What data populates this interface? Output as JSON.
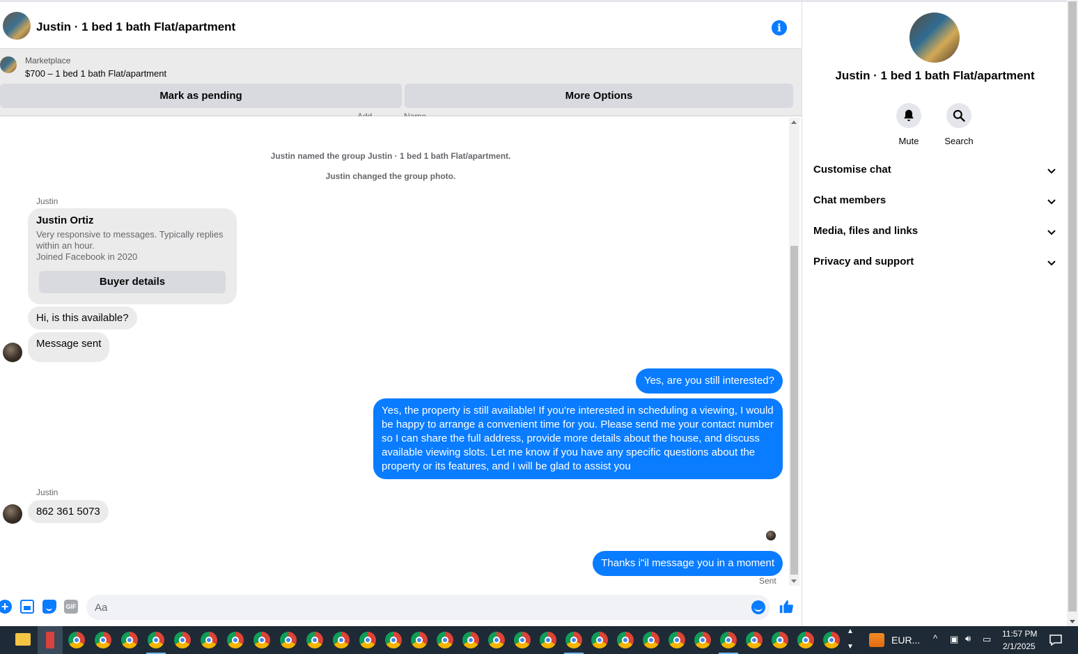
{
  "header": {
    "title": "Justin · 1 bed 1 bath Flat/apartment"
  },
  "listing": {
    "source": "Marketplace",
    "price_title": "$700 – 1 bed 1 bath Flat/apartment",
    "mark_pending": "Mark as pending",
    "more_options": "More Options"
  },
  "clipped_labels": [
    "Add",
    "Name"
  ],
  "system_messages": [
    "Justin named the group Justin · 1 bed 1 bath Flat/apartment.",
    "Justin changed the group photo."
  ],
  "profile_card": {
    "sender": "Justin",
    "name": "Justin Ortiz",
    "description": "Very responsive to messages. Typically replies within an hour.",
    "joined": "Joined Facebook in 2020",
    "button": "Buyer details"
  },
  "messages": {
    "in1": "Hi, is this available?",
    "in2": "Message sent",
    "out1": "Yes, are you still interested?",
    "out2": "Yes, the property is still available! If you're interested in scheduling a viewing, I would be happy to arrange a convenient time for you. Please send me your contact number so I can share the full address, provide more details about the house, and discuss available viewing slots. Let me know if you have any specific questions about the property or its features, and I will be glad to assist you",
    "sender2": "Justin",
    "in3": "862 361 5073",
    "out3": "Thanks i\"il message you in a moment",
    "status": "Sent"
  },
  "composer": {
    "placeholder": "Aa"
  },
  "panel": {
    "title": "Justin · 1 bed 1 bath Flat/apartment",
    "actions": {
      "mute": "Mute",
      "search": "Search"
    },
    "sections": [
      "Customise chat",
      "Chat members",
      "Media, files and links",
      "Privacy and support"
    ]
  },
  "taskbar": {
    "tray_label": "EUR...",
    "time": "11:57 PM",
    "date": "2/1/2025"
  },
  "colors": {
    "accent": "#0a7cff",
    "bubble_in": "#ebebeb",
    "taskbar": "#1e2a35"
  },
  "icons": [
    "info-icon",
    "plus-icon",
    "gallery-icon",
    "sticker-icon",
    "gif-icon",
    "emoji-icon",
    "like-icon",
    "bell-icon",
    "search-icon",
    "chevron-down-icon"
  ]
}
